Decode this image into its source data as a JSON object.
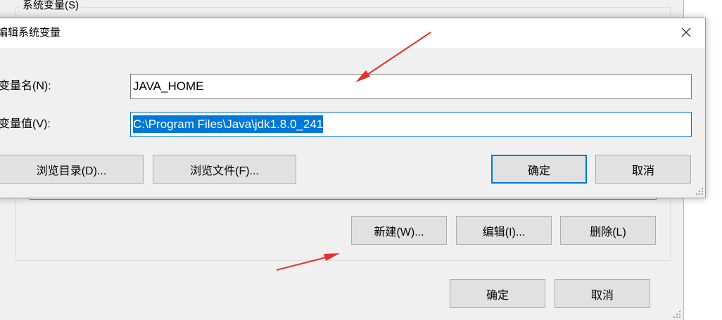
{
  "window": {
    "group_label": "系统变量(S)",
    "new_button": "新建(W)...",
    "edit_button": "编辑(I)...",
    "delete_button": "删除(L)",
    "ok_button": "确定",
    "cancel_button": "取消"
  },
  "dialog": {
    "title": "编辑系统变量",
    "name_label": "变量名(N):",
    "name_value": "JAVA_HOME",
    "value_label": "变量值(V):",
    "value_value": "C:\\Program Files\\Java\\jdk1.8.0_241",
    "value_selected": true,
    "browse_directory_button": "浏览目录(D)...",
    "browse_file_button": "浏览文件(F)...",
    "ok_button": "确定",
    "cancel_button": "取消"
  },
  "icons": {
    "dialog_close": "close-icon",
    "resize_grip": "resize-grip-icon",
    "annotation": "red-arrow-icon"
  },
  "colors": {
    "window_background": "#f0f0f0",
    "selection_highlight": "#0078d7",
    "focus_border": "#0078d7",
    "annotation_arrow": "#e5322d"
  }
}
